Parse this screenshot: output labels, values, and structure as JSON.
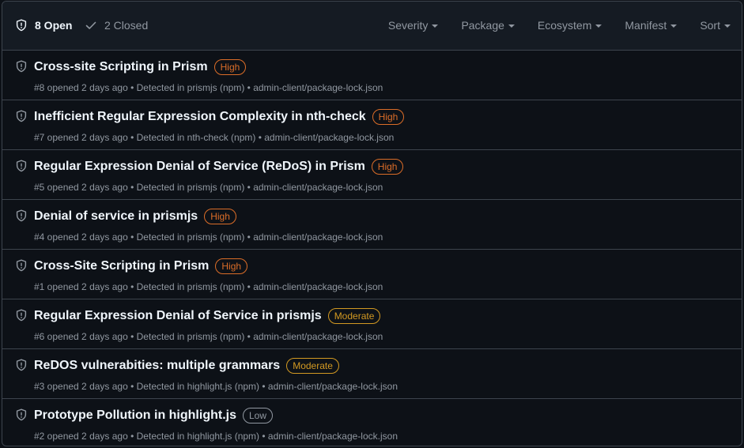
{
  "header": {
    "open_label": "8 Open",
    "closed_label": "2 Closed",
    "filters": [
      "Severity",
      "Package",
      "Ecosystem",
      "Manifest",
      "Sort"
    ]
  },
  "severity_colors": {
    "High": "#db6d28",
    "Moderate": "#d29922",
    "Low": "#9198a1"
  },
  "alerts": [
    {
      "title": "Cross-site Scripting in Prism",
      "severity": "High",
      "meta": "#8 opened 2 days ago • Detected in prismjs (npm) • admin-client/package-lock.json"
    },
    {
      "title": "Inefficient Regular Expression Complexity in nth-check",
      "severity": "High",
      "meta": "#7 opened 2 days ago • Detected in nth-check (npm) • admin-client/package-lock.json"
    },
    {
      "title": "Regular Expression Denial of Service (ReDoS) in Prism",
      "severity": "High",
      "meta": "#5 opened 2 days ago • Detected in prismjs (npm) • admin-client/package-lock.json"
    },
    {
      "title": "Denial of service in prismjs",
      "severity": "High",
      "meta": "#4 opened 2 days ago • Detected in prismjs (npm) • admin-client/package-lock.json"
    },
    {
      "title": "Cross-Site Scripting in Prism",
      "severity": "High",
      "meta": "#1 opened 2 days ago • Detected in prismjs (npm) • admin-client/package-lock.json"
    },
    {
      "title": "Regular Expression Denial of Service in prismjs",
      "severity": "Moderate",
      "meta": "#6 opened 2 days ago • Detected in prismjs (npm) • admin-client/package-lock.json"
    },
    {
      "title": "ReDOS vulnerabities: multiple grammars",
      "severity": "Moderate",
      "meta": "#3 opened 2 days ago • Detected in highlight.js (npm) • admin-client/package-lock.json"
    },
    {
      "title": "Prototype Pollution in highlight.js",
      "severity": "Low",
      "meta": "#2 opened 2 days ago • Detected in highlight.js (npm) • admin-client/package-lock.json"
    }
  ]
}
